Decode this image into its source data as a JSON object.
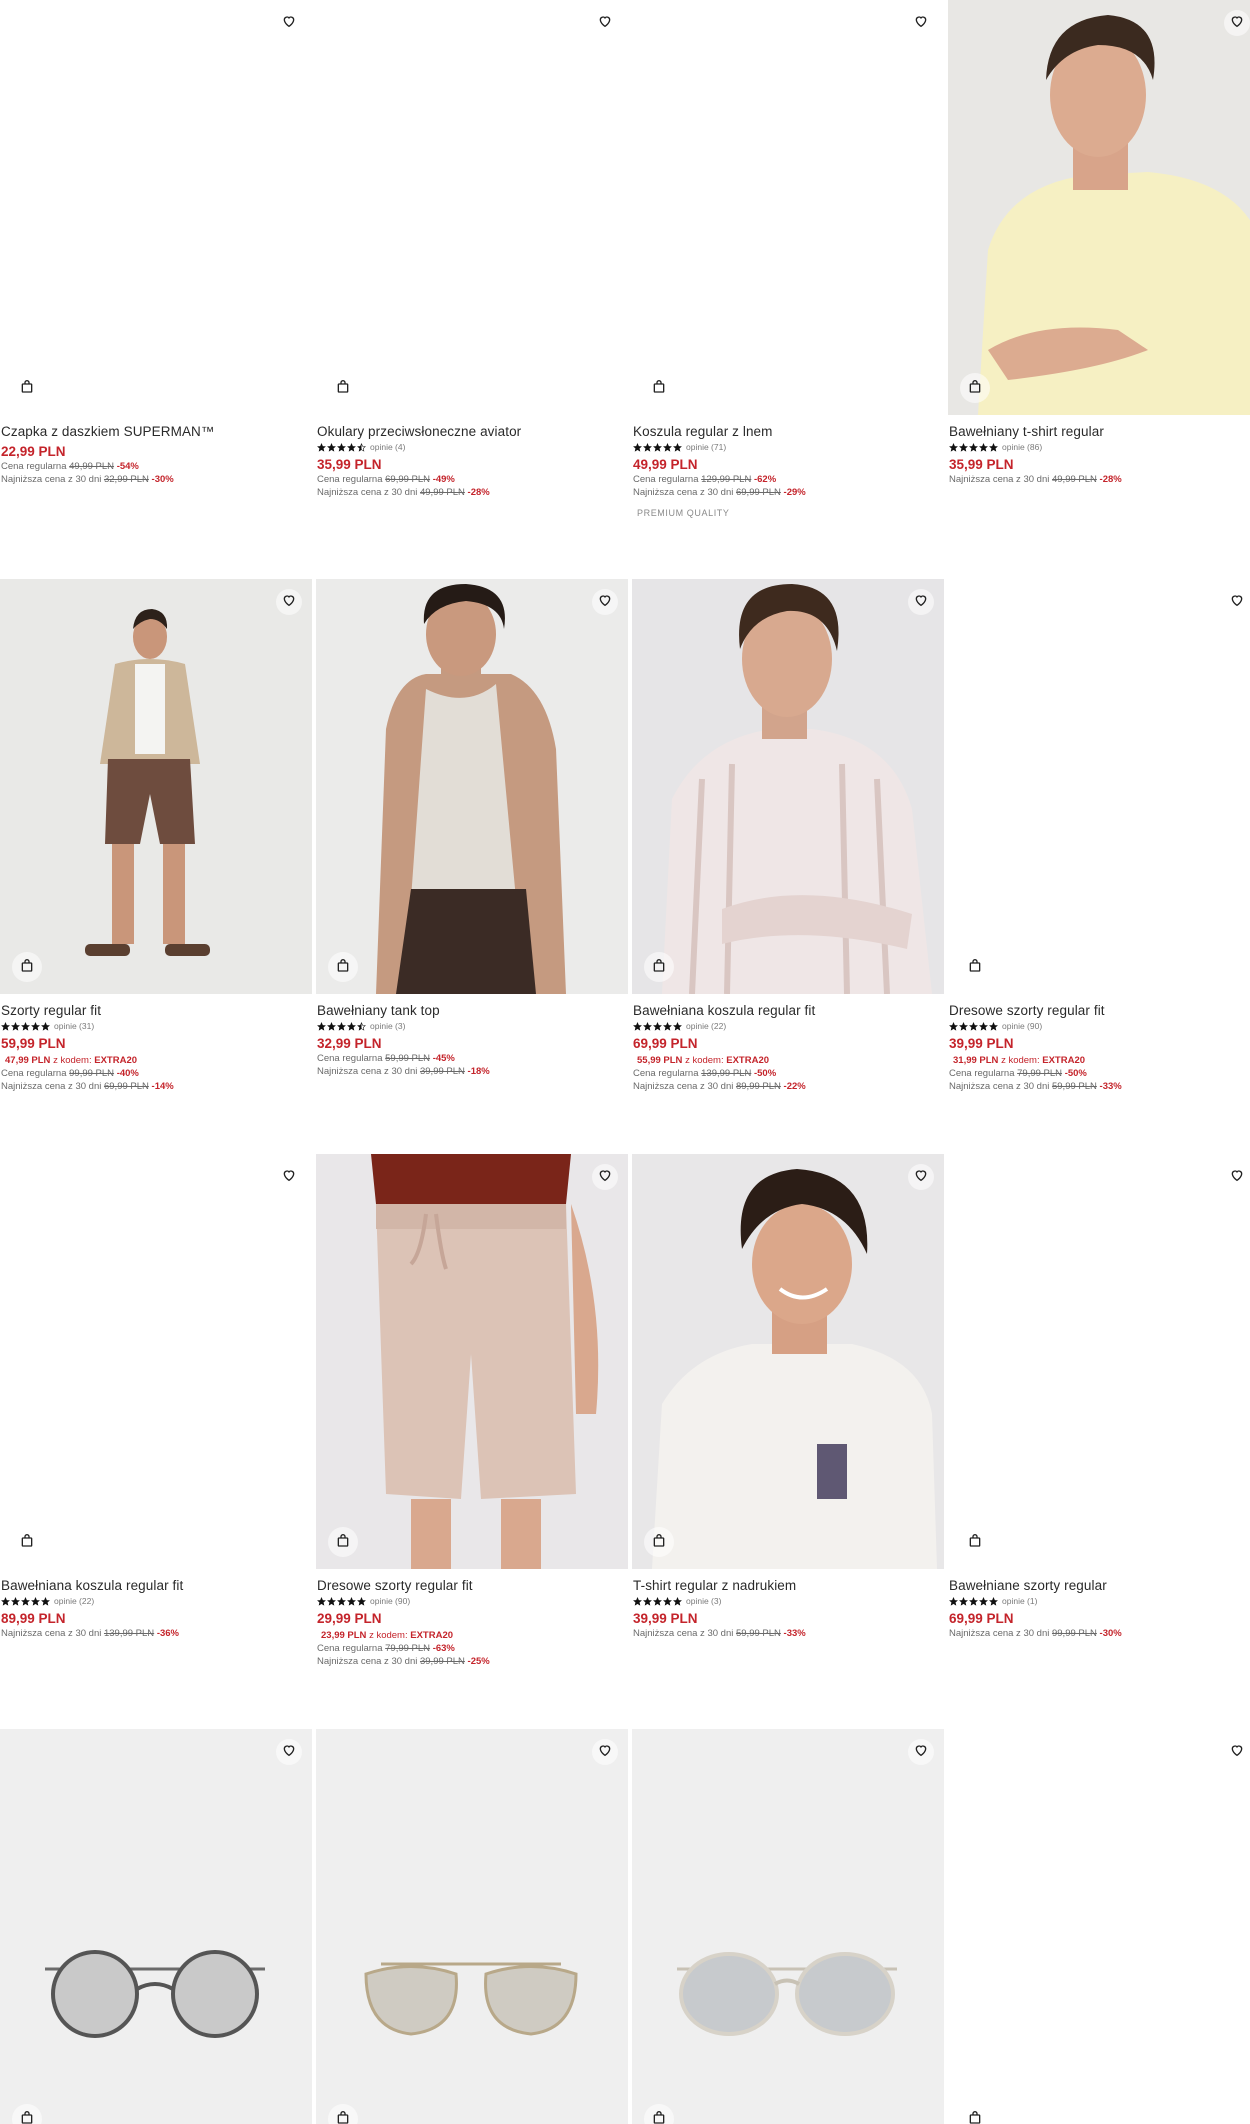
{
  "products": [
    {
      "name": "Czapka z daszkiem SUPERMAN™",
      "price": "22,99 PLN",
      "history": [
        {
          "label": "Cena regularna",
          "old": "49,99 PLN",
          "pct": "-54%"
        },
        {
          "label": "Najniższa cena z 30 dni",
          "old": "32,99 PLN",
          "pct": "-30%"
        }
      ]
    },
    {
      "name": "Okulary przeciwsłoneczne aviator",
      "rating": 4.5,
      "reviews": "opinie (4)",
      "price": "35,99 PLN",
      "history": [
        {
          "label": "Cena regularna",
          "old": "69,99 PLN",
          "pct": "-49%"
        },
        {
          "label": "Najniższa cena z 30 dni",
          "old": "49,99 PLN",
          "pct": "-28%"
        }
      ]
    },
    {
      "name": "Koszula regular z lnem",
      "rating": 5,
      "reviews": "opinie (71)",
      "price": "49,99 PLN",
      "history": [
        {
          "label": "Cena regularna",
          "old": "129,99 PLN",
          "pct": "-62%"
        },
        {
          "label": "Najniższa cena z 30 dni",
          "old": "69,99 PLN",
          "pct": "-29%"
        }
      ],
      "badge": "PREMIUM QUALITY"
    },
    {
      "name": "Bawełniany t-shirt regular",
      "rating": 5,
      "reviews": "opinie (86)",
      "price": "35,99 PLN",
      "history": [
        {
          "label": "Najniższa cena z 30 dni",
          "old": "49,99 PLN",
          "pct": "-28%"
        }
      ]
    },
    {
      "name": "Szorty regular fit",
      "rating": 5,
      "reviews": "opinie (31)",
      "price": "59,99 PLN",
      "code_price": "47,99 PLN",
      "code_label": "z kodem:",
      "code": "EXTRA20",
      "history": [
        {
          "label": "Cena regularna",
          "old": "99,99 PLN",
          "pct": "-40%"
        },
        {
          "label": "Najniższa cena z 30 dni",
          "old": "69,99 PLN",
          "pct": "-14%"
        }
      ]
    },
    {
      "name": "Bawełniany tank top",
      "rating": 4.5,
      "reviews": "opinie (3)",
      "price": "32,99 PLN",
      "history": [
        {
          "label": "Cena regularna",
          "old": "59,99 PLN",
          "pct": "-45%"
        },
        {
          "label": "Najniższa cena z 30 dni",
          "old": "39,99 PLN",
          "pct": "-18%"
        }
      ]
    },
    {
      "name": "Bawełniana koszula regular fit",
      "rating": 5,
      "reviews": "opinie (22)",
      "price": "69,99 PLN",
      "code_price": "55,99 PLN",
      "code_label": "z kodem:",
      "code": "EXTRA20",
      "history": [
        {
          "label": "Cena regularna",
          "old": "139,99 PLN",
          "pct": "-50%"
        },
        {
          "label": "Najniższa cena z 30 dni",
          "old": "89,99 PLN",
          "pct": "-22%"
        }
      ]
    },
    {
      "name": "Dresowe szorty regular fit",
      "rating": 5,
      "reviews": "opinie (90)",
      "price": "39,99 PLN",
      "code_price": "31,99 PLN",
      "code_label": "z kodem:",
      "code": "EXTRA20",
      "history": [
        {
          "label": "Cena regularna",
          "old": "79,99 PLN",
          "pct": "-50%"
        },
        {
          "label": "Najniższa cena z 30 dni",
          "old": "59,99 PLN",
          "pct": "-33%"
        }
      ]
    },
    {
      "name": "Bawełniana koszula regular fit",
      "rating": 5,
      "reviews": "opinie (22)",
      "price": "89,99 PLN",
      "history": [
        {
          "label": "Najniższa cena z 30 dni",
          "old": "139,99 PLN",
          "pct": "-36%"
        }
      ]
    },
    {
      "name": "Dresowe szorty regular fit",
      "rating": 5,
      "reviews": "opinie (90)",
      "price": "29,99 PLN",
      "code_price": "23,99 PLN",
      "code_label": "z kodem:",
      "code": "EXTRA20",
      "history": [
        {
          "label": "Cena regularna",
          "old": "79,99 PLN",
          "pct": "-63%"
        },
        {
          "label": "Najniższa cena z 30 dni",
          "old": "39,99 PLN",
          "pct": "-25%"
        }
      ]
    },
    {
      "name": "T-shirt regular z nadrukiem",
      "rating": 5,
      "reviews": "opinie (3)",
      "price": "39,99 PLN",
      "history": [
        {
          "label": "Najniższa cena z 30 dni",
          "old": "59,99 PLN",
          "pct": "-33%"
        }
      ]
    },
    {
      "name": "Bawełniane szorty regular",
      "rating": 5,
      "reviews": "opinie (1)",
      "price": "69,99 PLN",
      "history": [
        {
          "label": "Najniższa cena z 30 dni",
          "old": "99,99 PLN",
          "pct": "-30%"
        }
      ]
    }
  ],
  "icons": {
    "wishlist": "heart-icon",
    "cart": "shopping-bag-icon",
    "rating": "star-icon"
  },
  "colors": {
    "price": "#c4242b",
    "text": "#2a2a2a",
    "muted": "#6a6a6a"
  }
}
